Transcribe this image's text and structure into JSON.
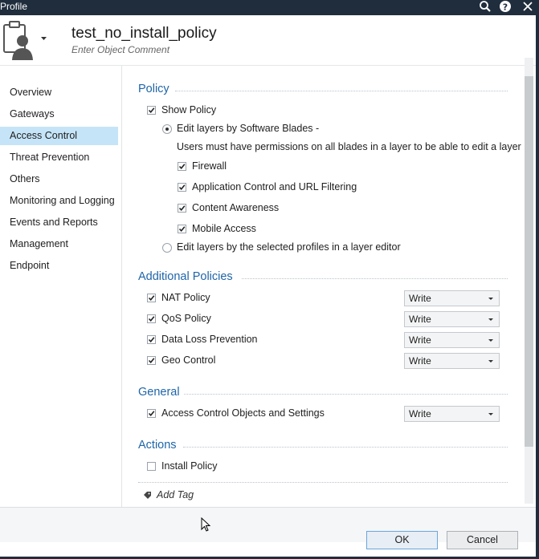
{
  "window": {
    "title": "Profile"
  },
  "header": {
    "object_name": "test_no_install_policy",
    "comment_placeholder": "Enter Object Comment"
  },
  "sidebar": {
    "items": [
      {
        "label": "Overview",
        "active": false
      },
      {
        "label": "Gateways",
        "active": false
      },
      {
        "label": "Access Control",
        "active": true
      },
      {
        "label": "Threat Prevention",
        "active": false
      },
      {
        "label": "Others",
        "active": false
      },
      {
        "label": "Monitoring and Logging",
        "active": false
      },
      {
        "label": "Events and Reports",
        "active": false
      },
      {
        "label": "Management",
        "active": false
      },
      {
        "label": "Endpoint",
        "active": false
      }
    ]
  },
  "policy": {
    "title": "Policy",
    "show_policy": {
      "label": "Show Policy",
      "checked": true
    },
    "edit_by_blades": {
      "label": "Edit layers by Software Blades -",
      "selected": true
    },
    "note": "Users must have permissions on all blades in a layer to be able to edit a layer",
    "blades": [
      {
        "label": "Firewall",
        "checked": true
      },
      {
        "label": "Application Control and URL Filtering",
        "checked": true
      },
      {
        "label": "Content Awareness",
        "checked": true
      },
      {
        "label": "Mobile Access",
        "checked": true
      }
    ],
    "edit_by_profiles": {
      "label": "Edit layers by the selected profiles in a layer editor",
      "selected": false
    }
  },
  "additional": {
    "title": "Additional Policies",
    "items": [
      {
        "label": "NAT Policy",
        "checked": true,
        "permission": "Write"
      },
      {
        "label": "QoS Policy",
        "checked": true,
        "permission": "Write"
      },
      {
        "label": "Data Loss Prevention",
        "checked": true,
        "permission": "Write"
      },
      {
        "label": "Geo Control",
        "checked": true,
        "permission": "Write"
      }
    ]
  },
  "general": {
    "title": "General",
    "items": [
      {
        "label": "Access Control Objects and Settings",
        "checked": true,
        "permission": "Write"
      }
    ]
  },
  "actions": {
    "title": "Actions",
    "items": [
      {
        "label": "Install Policy",
        "checked": false
      }
    ]
  },
  "tags": {
    "add_label": "Add Tag"
  },
  "footer": {
    "ok_label": "OK",
    "cancel_label": "Cancel"
  },
  "icons": {
    "search": "search-icon",
    "help": "help-icon",
    "close": "close-icon",
    "avatar": "user-profile-icon",
    "tag": "tag-icon"
  },
  "colors": {
    "accent": "#1e65a8",
    "active_nav": "#c6e4f7",
    "titlebar": "#1f2d3d"
  }
}
